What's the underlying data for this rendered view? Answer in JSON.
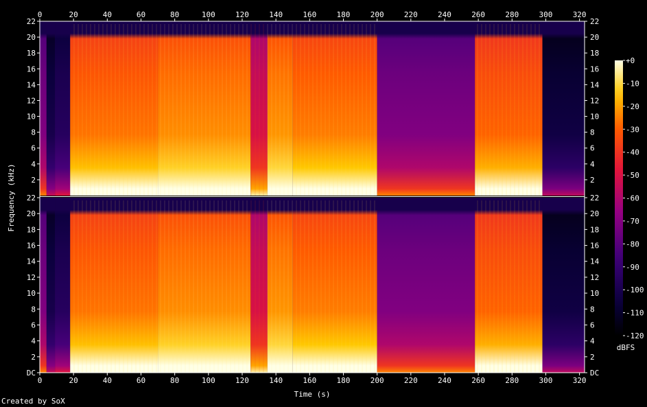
{
  "chart_data": {
    "type": "heatmap",
    "xlabel": "Time (s)",
    "ylabel": "Frequency (kHz)",
    "x_ticks": [
      0,
      20,
      40,
      60,
      80,
      100,
      120,
      140,
      160,
      180,
      200,
      220,
      240,
      260,
      280,
      300,
      320
    ],
    "xlim": [
      0,
      323
    ],
    "channels": [
      {
        "y_ticks": [
          "2",
          "4",
          "6",
          "8",
          "10",
          "12",
          "14",
          "16",
          "18",
          "20",
          "22"
        ],
        "ylim": [
          0,
          22
        ]
      },
      {
        "y_ticks": [
          "DC",
          "2",
          "4",
          "6",
          "8",
          "10",
          "12",
          "14",
          "16",
          "18",
          "20",
          "22"
        ],
        "ylim": [
          0,
          22
        ]
      }
    ],
    "colorbar": {
      "label": "dBFS",
      "ticks": [
        "+0",
        "-10",
        "-20",
        "-30",
        "-40",
        "-50",
        "-60",
        "-70",
        "-80",
        "-90",
        "-100",
        "-110",
        "-120"
      ],
      "range": [
        -120,
        0
      ]
    },
    "segments": [
      {
        "start": 0,
        "end": 4,
        "level": 0.45
      },
      {
        "start": 4,
        "end": 9,
        "level": 0.2
      },
      {
        "start": 9,
        "end": 18,
        "level": 0.25
      },
      {
        "start": 18,
        "end": 70,
        "level": 0.82
      },
      {
        "start": 70,
        "end": 125,
        "level": 0.85
      },
      {
        "start": 125,
        "end": 135,
        "level": 0.62
      },
      {
        "start": 135,
        "end": 150,
        "level": 0.86
      },
      {
        "start": 150,
        "end": 200,
        "level": 0.83
      },
      {
        "start": 200,
        "end": 258,
        "level": 0.45
      },
      {
        "start": 258,
        "end": 298,
        "level": 0.8
      },
      {
        "start": 298,
        "end": 323,
        "level": 0.18
      }
    ],
    "credit": "Created by SoX"
  }
}
